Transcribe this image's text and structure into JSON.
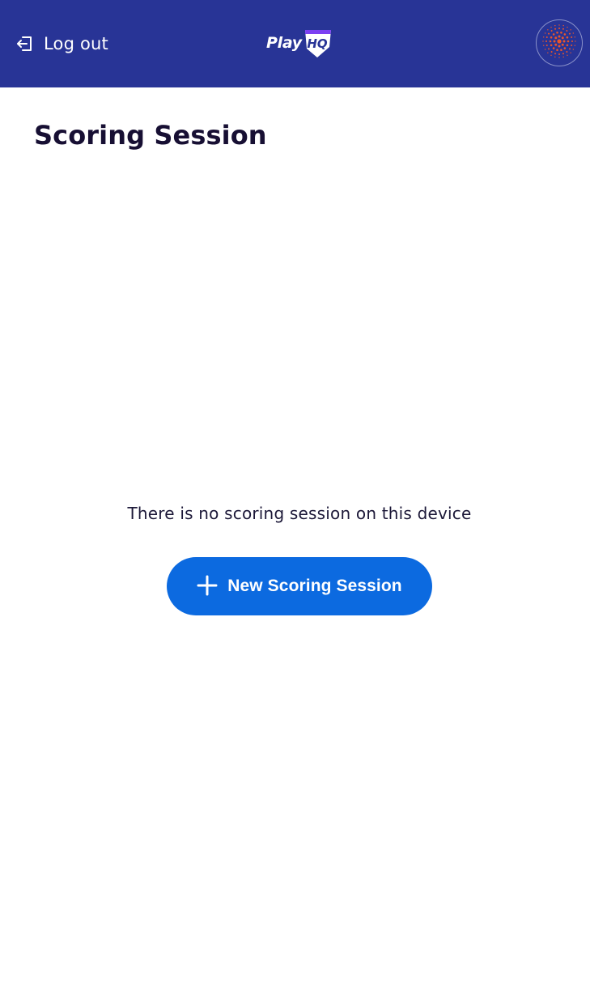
{
  "header": {
    "logout_label": "Log out",
    "logo_text": "Play",
    "logo_badge_text": "HQ",
    "icons": {
      "logout": "logout-icon",
      "avatar": "org-logo-icon"
    },
    "colors": {
      "background": "#283496",
      "logo_accent": "#7b3ff2",
      "avatar_dots": "#e8552b"
    }
  },
  "main": {
    "title": "Scoring Session",
    "empty_message": "There is no scoring session on this device",
    "new_button": {
      "label": "New Scoring Session",
      "icon": "plus-icon",
      "color": "#0c6ae0"
    }
  }
}
